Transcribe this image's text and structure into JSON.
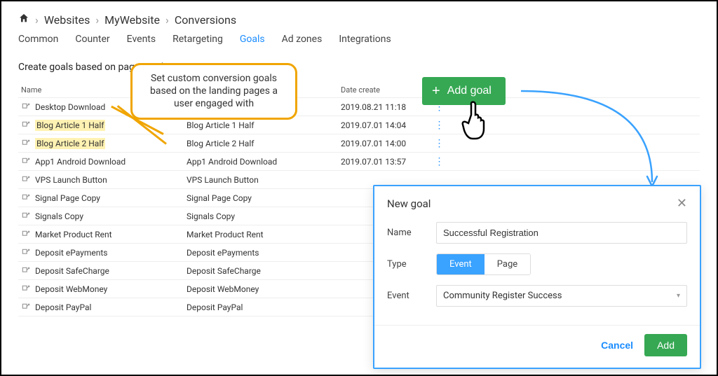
{
  "breadcrumb": {
    "items": [
      "Websites",
      "MyWebsite",
      "Conversions"
    ]
  },
  "tabs": {
    "items": [
      "Common",
      "Counter",
      "Events",
      "Retargeting",
      "Goals",
      "Ad zones",
      "Integrations"
    ],
    "active_index": 4
  },
  "subtitle": "Create goals based on pages and events",
  "annotation": "Set custom conversion goals based on the landing pages a user engaged with",
  "table": {
    "header_name": "Name",
    "header_date": "Date create",
    "rows": [
      {
        "name": "Desktop Download",
        "display": "Desktop Download",
        "date": "2019.08.21 11:18",
        "menu": true,
        "highlight": false
      },
      {
        "name": "Blog Article 1 Half",
        "display": "Blog Article 1 Half",
        "date": "2019.07.01 14:04",
        "menu": true,
        "highlight": true
      },
      {
        "name": "Blog Article 2 Half",
        "display": "Blog Article 2 Half",
        "date": "2019.07.01 14:00",
        "menu": true,
        "highlight": true
      },
      {
        "name": "App1 Android Download",
        "display": "App1 Android Download",
        "date": "2019.07.01 13:57",
        "menu": true,
        "highlight": false
      },
      {
        "name": "VPS Launch Button",
        "display": "VPS Launch Button",
        "date": "",
        "menu": false,
        "highlight": false
      },
      {
        "name": "Signal Page Copy",
        "display": "Signal Page Copy",
        "date": "",
        "menu": false,
        "highlight": false
      },
      {
        "name": "Signals Copy",
        "display": "Signals Copy",
        "date": "",
        "menu": false,
        "highlight": false
      },
      {
        "name": "Market Product Rent",
        "display": "Market Product Rent",
        "date": "",
        "menu": false,
        "highlight": false
      },
      {
        "name": "Deposit ePayments",
        "display": "Deposit ePayments",
        "date": "",
        "menu": false,
        "highlight": false
      },
      {
        "name": "Deposit SafeCharge",
        "display": "Deposit SafeCharge",
        "date": "",
        "menu": false,
        "highlight": false
      },
      {
        "name": "Deposit WebMoney",
        "display": "Deposit WebMoney",
        "date": "",
        "menu": false,
        "highlight": false
      },
      {
        "name": "Deposit PayPal",
        "display": "Deposit PayPal",
        "date": "",
        "menu": false,
        "highlight": false
      }
    ]
  },
  "add_goal_button": "Add goal",
  "modal": {
    "title": "New goal",
    "labels": {
      "name": "Name",
      "type": "Type",
      "event": "Event"
    },
    "name_value": "Successful Registration",
    "type_options": [
      "Event",
      "Page"
    ],
    "type_active": 0,
    "event_value": "Community Register Success",
    "cancel": "Cancel",
    "add": "Add"
  }
}
